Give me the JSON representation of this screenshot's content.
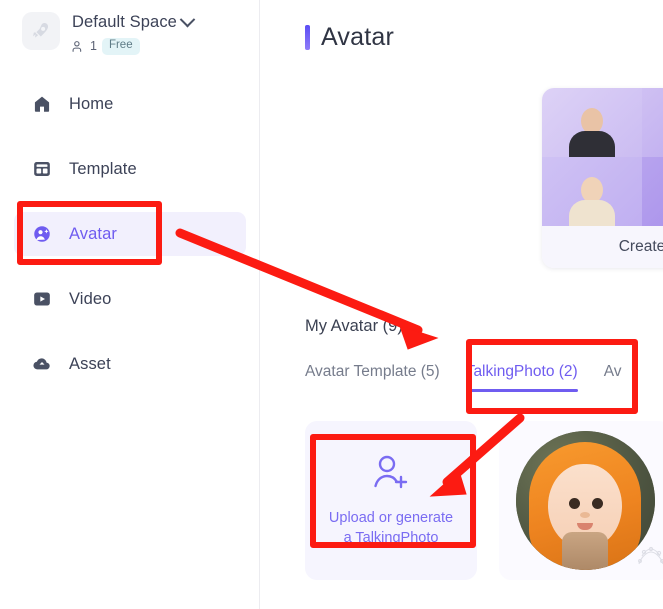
{
  "sidebar": {
    "space": {
      "logo_icon": "rocket-icon",
      "name": "Default Space",
      "chevron_icon": "chevron-down-icon",
      "member_icon": "members-icon",
      "member_count": "1",
      "plan_badge": "Free"
    },
    "items": [
      {
        "label": "Home",
        "icon": "home-icon",
        "active": false
      },
      {
        "label": "Template",
        "icon": "template-icon",
        "active": false
      },
      {
        "label": "Avatar",
        "icon": "avatar-icon",
        "active": true
      },
      {
        "label": "Video",
        "icon": "video-icon",
        "active": false
      },
      {
        "label": "Asset",
        "icon": "cloud-icon",
        "active": false
      }
    ]
  },
  "main": {
    "page_title": "Avatar",
    "create_card": {
      "footer_label": "Create",
      "thumbnails": [
        "avatar-thumb-1",
        "avatar-thumb-2",
        "avatar-thumb-3",
        "avatar-thumb-4"
      ]
    },
    "section": {
      "title": "My Avatar (9)",
      "tabs": [
        {
          "label": "Avatar Template (5)",
          "active": false
        },
        {
          "label": "TalkingPhoto (2)",
          "active": true
        },
        {
          "label": "Av",
          "active": false
        }
      ]
    },
    "avatar_grid": {
      "upload_card": {
        "icon": "user-add-icon",
        "label_line1": "Upload or generate",
        "label_line2": "a TalkingPhoto"
      },
      "photo_card": {
        "image": "baby-in-orange-hood-photo"
      }
    }
  },
  "annotations": {
    "boxes": [
      {
        "name": "avatar-nav-highlight",
        "color": "#fc1b12"
      },
      {
        "name": "talkingphoto-tab-highlight",
        "color": "#fc1b12"
      },
      {
        "name": "upload-card-highlight",
        "color": "#fc1b12"
      }
    ],
    "arrows": [
      {
        "name": "arrow-nav-to-section",
        "color": "#fc1b12"
      },
      {
        "name": "arrow-tab-to-upload",
        "color": "#fc1b12"
      }
    ]
  },
  "colors": {
    "accent_purple": "#6f5cf0",
    "annotation_red": "#fc1b12",
    "nav_active_bg": "#f2f0fd",
    "badge_free_bg": "#e3f4f7",
    "text_primary": "#3c4257",
    "text_muted": "#767c8c"
  }
}
